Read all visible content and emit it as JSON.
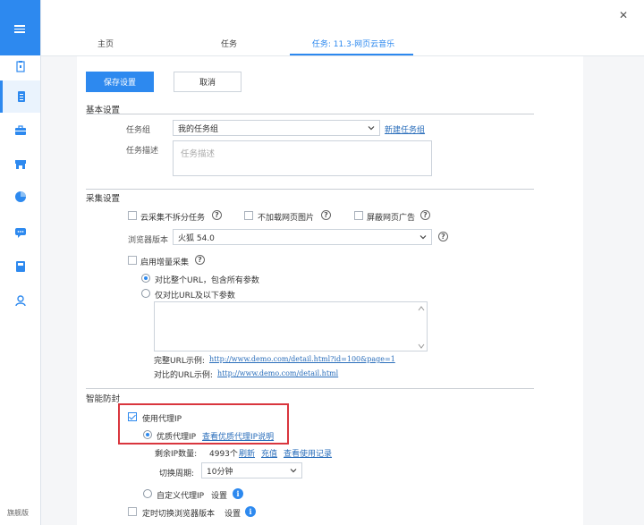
{
  "sidebar": {
    "icons": [
      "clipboard-icon",
      "document-icon",
      "briefcase-icon",
      "store-icon",
      "pie-chart-icon",
      "chat-icon",
      "book-icon",
      "user-icon"
    ],
    "footer_label": "旗舰版"
  },
  "tabs": [
    {
      "label": "主页"
    },
    {
      "label": "任务"
    },
    {
      "label": "任务: 11.3-网页云音乐"
    }
  ],
  "toolbar": {
    "save_label": "保存设置",
    "cancel_label": "取消"
  },
  "basic": {
    "title": "基本设置",
    "group_label": "任务组",
    "group_value": "我的任务组",
    "new_group_link": "新建任务组",
    "desc_label": "任务描述",
    "desc_placeholder": "任务描述"
  },
  "collect": {
    "title": "采集设置",
    "options": [
      {
        "label": "云采集不拆分任务",
        "checked": false
      },
      {
        "label": "不加载网页图片",
        "checked": false
      },
      {
        "label": "屏蔽网页广告",
        "checked": false
      }
    ],
    "browser_label": "浏览器版本",
    "browser_value": "火狐 54.0",
    "incremental_label": "启用增量采集",
    "radio_full": "对比整个URL，包含所有参数",
    "radio_partial": "仅对比URL及以下参数",
    "example_full_label": "完整URL示例:",
    "example_full_url": "http://www.demo.com/detail.html?id=100&page=1",
    "example_compare_label": "对比的URL示例:",
    "example_compare_url": "http://www.demo.com/detail.html"
  },
  "anti_block": {
    "title": "智能防封",
    "use_proxy_label": "使用代理IP",
    "premium_proxy_label": "优质代理IP",
    "premium_proxy_link": "查看优质代理IP说明",
    "remaining_label": "剩余IP数量:",
    "remaining_value": "4993个",
    "refresh_link": "刷新",
    "recharge_link": "充值",
    "usage_link": "查看使用记录",
    "cycle_label": "切换周期:",
    "cycle_value": "10分钟",
    "custom_proxy_label": "自定义代理IP",
    "custom_proxy_settings": "设置",
    "timed_switch_label": "定时切换浏览器版本",
    "timed_switch_settings": "设置"
  },
  "colors": {
    "accent": "#2d89ef",
    "highlight_box": "#d9363e"
  }
}
